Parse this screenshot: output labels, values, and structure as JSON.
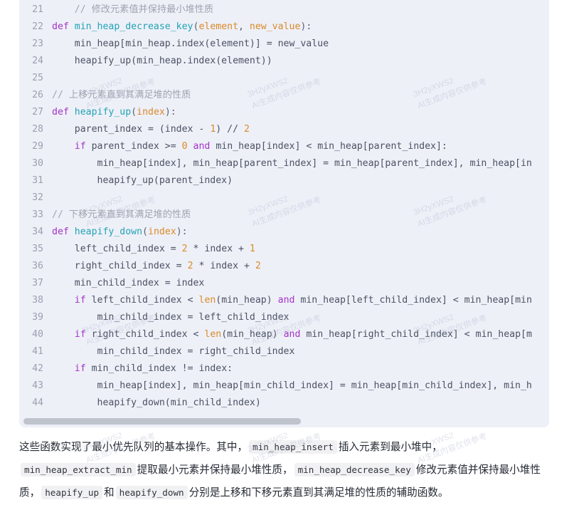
{
  "code_block": {
    "language": "python",
    "first_line_number": 21,
    "background_color": "#eef0f8",
    "scrollbar": {
      "visible": true,
      "orientation": "horizontal"
    },
    "lines": [
      {
        "num": "21",
        "tokens": [
          {
            "t": "    ",
            "c": "pun"
          },
          {
            "t": "// 修改元素值并保持最小堆性质",
            "c": "com"
          }
        ]
      },
      {
        "num": "22",
        "tokens": [
          {
            "t": "",
            "c": "pun"
          },
          {
            "t": "def ",
            "c": "kw"
          },
          {
            "t": "min_heap_decrease_key",
            "c": "fn"
          },
          {
            "t": "(",
            "c": "pun"
          },
          {
            "t": "element",
            "c": "param"
          },
          {
            "t": ", ",
            "c": "pun"
          },
          {
            "t": "new_value",
            "c": "param"
          },
          {
            "t": "):",
            "c": "pun"
          }
        ]
      },
      {
        "num": "23",
        "tokens": [
          {
            "t": "    min_heap[min_heap.index(element)] = new_value",
            "c": "id"
          }
        ]
      },
      {
        "num": "24",
        "tokens": [
          {
            "t": "    heapify_up(min_heap.index(element))",
            "c": "id"
          }
        ]
      },
      {
        "num": "25",
        "tokens": [
          {
            "t": "",
            "c": "id"
          }
        ]
      },
      {
        "num": "26",
        "tokens": [
          {
            "t": "",
            "c": "pun"
          },
          {
            "t": "// 上移元素直到其满足堆的性质",
            "c": "com"
          }
        ]
      },
      {
        "num": "27",
        "tokens": [
          {
            "t": "def ",
            "c": "kw"
          },
          {
            "t": "heapify_up",
            "c": "fn"
          },
          {
            "t": "(",
            "c": "pun"
          },
          {
            "t": "index",
            "c": "param"
          },
          {
            "t": "):",
            "c": "pun"
          }
        ]
      },
      {
        "num": "28",
        "tokens": [
          {
            "t": "    parent_index = (index - ",
            "c": "id"
          },
          {
            "t": "1",
            "c": "num"
          },
          {
            "t": ") ",
            "c": "id"
          },
          {
            "t": "// ",
            "c": "id"
          },
          {
            "t": "2",
            "c": "num"
          }
        ]
      },
      {
        "num": "29",
        "tokens": [
          {
            "t": "    ",
            "c": "id"
          },
          {
            "t": "if ",
            "c": "kw"
          },
          {
            "t": "parent_index >= ",
            "c": "id"
          },
          {
            "t": "0",
            "c": "num"
          },
          {
            "t": " ",
            "c": "id"
          },
          {
            "t": "and ",
            "c": "kw"
          },
          {
            "t": "min_heap[index] < min_heap[parent_index]:",
            "c": "id"
          }
        ]
      },
      {
        "num": "30",
        "tokens": [
          {
            "t": "        min_heap[index], min_heap[parent_index] = min_heap[parent_index], min_heap[in",
            "c": "id"
          }
        ]
      },
      {
        "num": "31",
        "tokens": [
          {
            "t": "        heapify_up(parent_index)",
            "c": "id"
          }
        ]
      },
      {
        "num": "32",
        "tokens": [
          {
            "t": "",
            "c": "id"
          }
        ]
      },
      {
        "num": "33",
        "tokens": [
          {
            "t": "",
            "c": "pun"
          },
          {
            "t": "// 下移元素直到其满足堆的性质",
            "c": "com"
          }
        ]
      },
      {
        "num": "34",
        "tokens": [
          {
            "t": "def ",
            "c": "kw"
          },
          {
            "t": "heapify_down",
            "c": "fn"
          },
          {
            "t": "(",
            "c": "pun"
          },
          {
            "t": "index",
            "c": "param"
          },
          {
            "t": "):",
            "c": "pun"
          }
        ]
      },
      {
        "num": "35",
        "tokens": [
          {
            "t": "    left_child_index = ",
            "c": "id"
          },
          {
            "t": "2",
            "c": "num"
          },
          {
            "t": " * index + ",
            "c": "id"
          },
          {
            "t": "1",
            "c": "num"
          }
        ]
      },
      {
        "num": "36",
        "tokens": [
          {
            "t": "    right_child_index = ",
            "c": "id"
          },
          {
            "t": "2",
            "c": "num"
          },
          {
            "t": " * index + ",
            "c": "id"
          },
          {
            "t": "2",
            "c": "num"
          }
        ]
      },
      {
        "num": "37",
        "tokens": [
          {
            "t": "    min_child_index = index",
            "c": "id"
          }
        ]
      },
      {
        "num": "38",
        "tokens": [
          {
            "t": "    ",
            "c": "id"
          },
          {
            "t": "if ",
            "c": "kw"
          },
          {
            "t": "left_child_index < ",
            "c": "id"
          },
          {
            "t": "len",
            "c": "bi"
          },
          {
            "t": "(min_heap) ",
            "c": "id"
          },
          {
            "t": "and ",
            "c": "kw"
          },
          {
            "t": "min_heap[left_child_index] < min_heap[min",
            "c": "id"
          }
        ]
      },
      {
        "num": "39",
        "tokens": [
          {
            "t": "        min_child_index = left_child_index",
            "c": "id"
          }
        ]
      },
      {
        "num": "40",
        "tokens": [
          {
            "t": "    ",
            "c": "id"
          },
          {
            "t": "if ",
            "c": "kw"
          },
          {
            "t": "right_child_index < ",
            "c": "id"
          },
          {
            "t": "len",
            "c": "bi"
          },
          {
            "t": "(min_heap) ",
            "c": "id"
          },
          {
            "t": "and ",
            "c": "kw"
          },
          {
            "t": "min_heap[right_child_index] < min_heap[m",
            "c": "id"
          }
        ]
      },
      {
        "num": "41",
        "tokens": [
          {
            "t": "        min_child_index = right_child_index",
            "c": "id"
          }
        ]
      },
      {
        "num": "42",
        "tokens": [
          {
            "t": "    ",
            "c": "id"
          },
          {
            "t": "if ",
            "c": "kw"
          },
          {
            "t": "min_child_index != index:",
            "c": "id"
          }
        ]
      },
      {
        "num": "43",
        "tokens": [
          {
            "t": "        min_heap[index], min_heap[min_child_index] = min_heap[min_child_index], min_h",
            "c": "id"
          }
        ]
      },
      {
        "num": "44",
        "tokens": [
          {
            "t": "        heapify_down(min_child_index)",
            "c": "id"
          }
        ]
      }
    ]
  },
  "prose": {
    "segments": [
      {
        "type": "text",
        "value": "这些函数实现了最小优先队列的基本操作。其中，"
      },
      {
        "type": "code",
        "value": "min_heap_insert"
      },
      {
        "type": "text",
        "value": "插入元素到最小堆中，"
      },
      {
        "type": "code",
        "value": "min_heap_extract_min"
      },
      {
        "type": "text",
        "value": "提取最小元素并保持最小堆性质，"
      },
      {
        "type": "code",
        "value": "min_heap_decrease_key"
      },
      {
        "type": "text",
        "value": "修改元素值并保持最小堆性质，"
      },
      {
        "type": "code",
        "value": "heapify_up"
      },
      {
        "type": "text",
        "value": "和"
      },
      {
        "type": "code",
        "value": "heapify_down"
      },
      {
        "type": "text",
        "value": "分别是上移和下移元素直到其满足堆的性质的辅助函数。"
      }
    ]
  },
  "watermark": {
    "line1": "3H2yXWS2",
    "line2": "AI生成内容仅供参考",
    "color": "#9aa3bb"
  }
}
